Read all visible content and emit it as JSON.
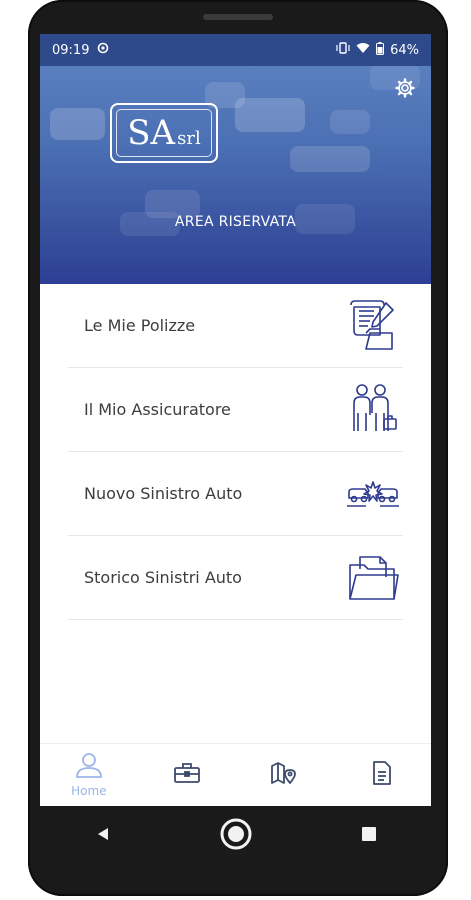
{
  "status_bar": {
    "time": "09:19",
    "battery": "64%"
  },
  "header": {
    "logo_main": "SA",
    "logo_sub": "srl",
    "area_title": "AREA RISERVATA",
    "accent_color": "#2d3f93"
  },
  "menu": {
    "items": [
      {
        "label": "Le Mie Polizze",
        "icon": "documents-signature-icon"
      },
      {
        "label": "Il Mio Assicuratore",
        "icon": "people-briefcase-icon"
      },
      {
        "label": "Nuovo Sinistro Auto",
        "icon": "car-crash-icon"
      },
      {
        "label": "Storico Sinistri Auto",
        "icon": "folder-icon"
      }
    ]
  },
  "bottom_nav": {
    "items": [
      {
        "label": "Home",
        "icon": "user-icon",
        "active": true
      },
      {
        "label": "",
        "icon": "briefcase-icon",
        "active": false
      },
      {
        "label": "",
        "icon": "map-pin-icon",
        "active": false
      },
      {
        "label": "",
        "icon": "document-icon",
        "active": false
      }
    ],
    "active_color": "#9bb6e7",
    "icon_color": "#3d4a6b"
  }
}
